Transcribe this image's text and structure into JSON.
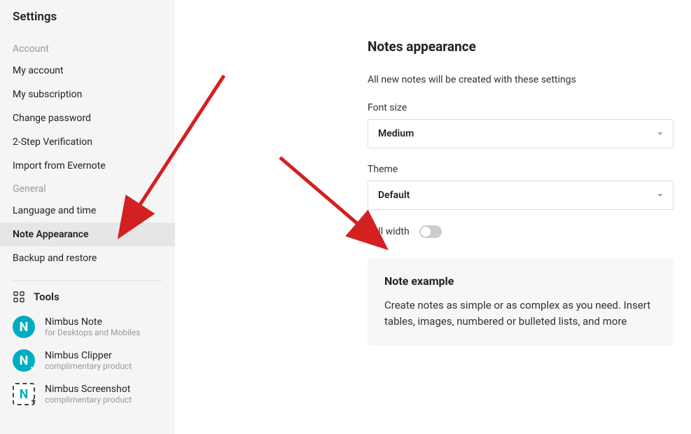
{
  "sidebar": {
    "title": "Settings",
    "sections": [
      {
        "header": "Account",
        "items": [
          "My account",
          "My subscription",
          "Change password",
          "2-Step Verification",
          "Import from Evernote"
        ]
      },
      {
        "header": "General",
        "items": [
          "Language and time",
          "Note Appearance",
          "Backup and restore"
        ]
      }
    ],
    "tools_header": "Tools",
    "tools": [
      {
        "name": "Nimbus Note",
        "sub": "for Desktops and Mobiles"
      },
      {
        "name": "Nimbus Clipper",
        "sub": "complimentary product"
      },
      {
        "name": "Nimbus Screenshot",
        "sub": "complimentary product"
      }
    ]
  },
  "main": {
    "title": "Notes appearance",
    "subtitle": "All new notes will be created with these settings",
    "font_size_label": "Font size",
    "font_size_value": "Medium",
    "theme_label": "Theme",
    "theme_value": "Default",
    "full_width_label": "Full width",
    "example_title": "Note example",
    "example_text": "Create notes as simple or as complex as you need. Insert tables, images, numbered or bulleted lists, and more"
  },
  "active_item": "Note Appearance"
}
